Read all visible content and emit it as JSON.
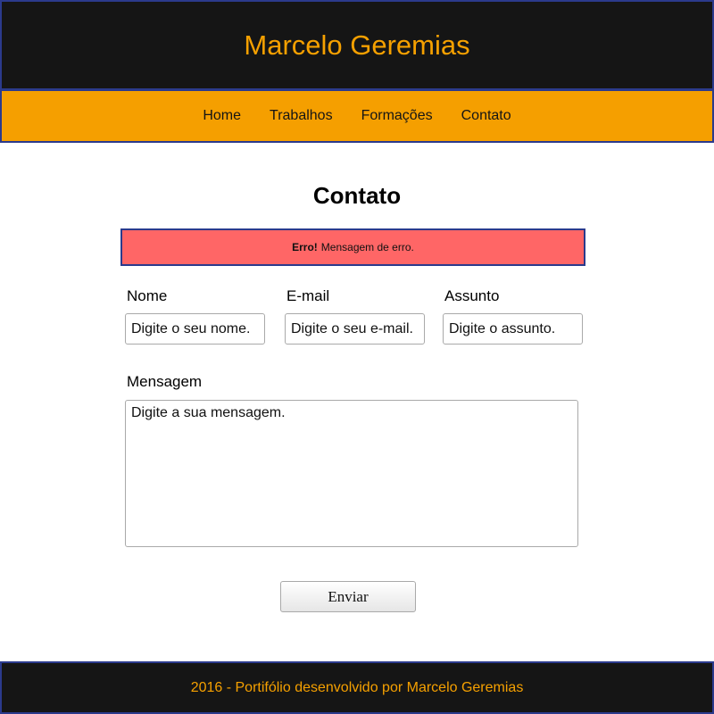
{
  "header": {
    "title": "Marcelo Geremias"
  },
  "nav": {
    "items": [
      {
        "label": "Home"
      },
      {
        "label": "Trabalhos"
      },
      {
        "label": "Formações"
      },
      {
        "label": "Contato"
      }
    ]
  },
  "main": {
    "title": "Contato",
    "alert": {
      "strong": "Erro!",
      "message": "Mensagem de erro."
    },
    "form": {
      "name": {
        "label": "Nome",
        "placeholder": "Digite o seu nome."
      },
      "email": {
        "label": "E-mail",
        "placeholder": "Digite o seu e-mail."
      },
      "subject": {
        "label": "Assunto",
        "placeholder": "Digite o assunto."
      },
      "message": {
        "label": "Mensagem",
        "placeholder": "Digite a sua mensagem."
      },
      "submit_label": "Enviar"
    }
  },
  "footer": {
    "text": "2016 - Portifólio desenvolvido por Marcelo Geremias"
  },
  "colors": {
    "accent": "#f59f00",
    "dark": "#151515",
    "border": "#2b3a8c",
    "error": "#ff6666"
  }
}
